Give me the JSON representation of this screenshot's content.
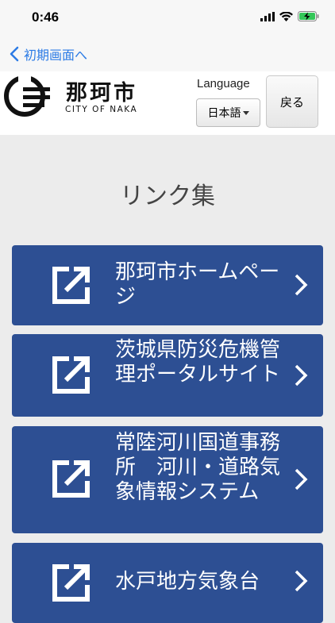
{
  "status": {
    "time": "0:46"
  },
  "nav": {
    "back_label": "初期画面へ"
  },
  "header": {
    "logo_kanji": "那珂市",
    "logo_sub": "CITY OF NAKA",
    "language_label": "Language",
    "language_value": "日本語",
    "back_button": "戻る"
  },
  "page": {
    "title": "リンク集"
  },
  "links": [
    {
      "label": "那珂市ホームページ"
    },
    {
      "label": "茨城県防災危機管理ポータルサイト"
    },
    {
      "label": "常陸河川国道事務所　河川・道路気象情報システム"
    },
    {
      "label": "水戸地方気象台"
    }
  ],
  "colors": {
    "button_bg": "#2d4f93",
    "page_bg": "#ececec",
    "accent": "#2c7be5"
  }
}
